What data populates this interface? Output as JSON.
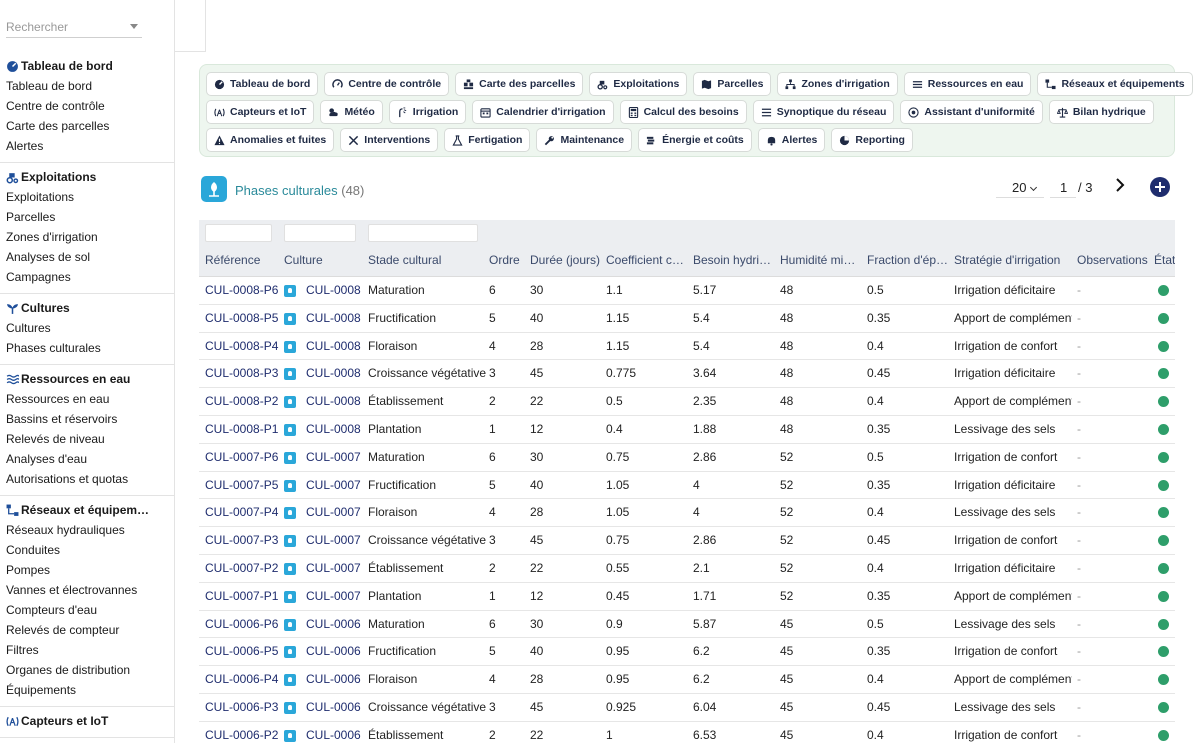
{
  "sidebar": {
    "search_placeholder": "Rechercher",
    "groups": [
      {
        "title": "Tableau de bord",
        "icon": "dashboard-gauge-icon",
        "items": [
          "Tableau de bord",
          "Centre de contrôle",
          "Carte des parcelles",
          "Alertes"
        ]
      },
      {
        "title": "Exploitations",
        "icon": "tractor-icon",
        "items": [
          "Exploitations",
          "Parcelles",
          "Zones d'irrigation",
          "Analyses de sol",
          "Campagnes"
        ]
      },
      {
        "title": "Cultures",
        "icon": "sprout-icon",
        "items": [
          "Cultures",
          "Phases culturales"
        ]
      },
      {
        "title": "Ressources en eau",
        "icon": "water-waves-icon",
        "items": [
          "Ressources en eau",
          "Bassins et réservoirs",
          "Relevés de niveau",
          "Analyses d'eau",
          "Autorisations et quotas"
        ]
      },
      {
        "title": "Réseaux et équipem…",
        "icon": "network-icon",
        "items": [
          "Réseaux hydrauliques",
          "Conduites",
          "Pompes",
          "Vannes et électrovannes",
          "Compteurs d'eau",
          "Relevés de compteur",
          "Filtres",
          "Organes de distribution",
          "Équipements"
        ]
      },
      {
        "title": "Capteurs et IoT",
        "icon": "sensor-icon",
        "items": []
      }
    ]
  },
  "quick_links": {
    "rows": [
      [
        {
          "label": "Tableau de bord",
          "icon": "gauge-icon"
        },
        {
          "label": "Centre de contrôle",
          "icon": "control-icon"
        },
        {
          "label": "Carte des parcelles",
          "icon": "map-grid-icon"
        },
        {
          "label": "Exploitations",
          "icon": "tractor-icon"
        },
        {
          "label": "Parcelles",
          "icon": "map-icon"
        },
        {
          "label": "Zones d'irrigation",
          "icon": "sitemap-icon"
        },
        {
          "label": "Ressources en eau",
          "icon": "water-icon"
        },
        {
          "label": "Réseaux et équipements",
          "icon": "network-icon"
        }
      ],
      [
        {
          "label": "Capteurs et IoT",
          "icon": "sensor-icon"
        },
        {
          "label": "Météo",
          "icon": "cloud-sun-icon"
        },
        {
          "label": "Irrigation",
          "icon": "sprinkler-icon"
        },
        {
          "label": "Calendrier d'irrigation",
          "icon": "calendar-icon"
        },
        {
          "label": "Calcul des besoins",
          "icon": "calculator-icon"
        },
        {
          "label": "Synoptique du réseau",
          "icon": "list-icon"
        },
        {
          "label": "Assistant d'uniformité",
          "icon": "target-icon"
        },
        {
          "label": "Bilan hydrique",
          "icon": "balance-icon"
        }
      ],
      [
        {
          "label": "Anomalies et fuites",
          "icon": "warning-icon"
        },
        {
          "label": "Interventions",
          "icon": "tools-icon"
        },
        {
          "label": "Fertigation",
          "icon": "flask-icon"
        },
        {
          "label": "Maintenance",
          "icon": "wrench-icon"
        },
        {
          "label": "Énergie et coûts",
          "icon": "coins-icon"
        },
        {
          "label": "Alertes",
          "icon": "bell-icon"
        },
        {
          "label": "Reporting",
          "icon": "chart-pie-icon"
        }
      ]
    ]
  },
  "list": {
    "title": "Phases culturales",
    "count": "(48)",
    "page_size": "20",
    "page": "1",
    "page_total": "/  3"
  },
  "table": {
    "columns": [
      "Référence",
      "Culture",
      "Stade cultural",
      "Ordre",
      "Durée (jours)",
      "Coefficient c…",
      "Besoin hydri…",
      "Humidité mi…",
      "Fraction d'ép…",
      "Stratégie d'irrigation",
      "Observations",
      "État"
    ],
    "rows": [
      [
        "CUL-0008-P6",
        "CUL-0008",
        "Maturation",
        "6",
        "30",
        "1.1",
        "5.17",
        "48",
        "0.5",
        "Irrigation déficitaire",
        "-"
      ],
      [
        "CUL-0008-P5",
        "CUL-0008",
        "Fructification",
        "5",
        "40",
        "1.15",
        "5.4",
        "48",
        "0.35",
        "Apport de complément",
        "-"
      ],
      [
        "CUL-0008-P4",
        "CUL-0008",
        "Floraison",
        "4",
        "28",
        "1.15",
        "5.4",
        "48",
        "0.4",
        "Irrigation de confort",
        "-"
      ],
      [
        "CUL-0008-P3",
        "CUL-0008",
        "Croissance végétative",
        "3",
        "45",
        "0.775",
        "3.64",
        "48",
        "0.45",
        "Irrigation déficitaire",
        "-"
      ],
      [
        "CUL-0008-P2",
        "CUL-0008",
        "Établissement",
        "2",
        "22",
        "0.5",
        "2.35",
        "48",
        "0.4",
        "Apport de complément",
        "-"
      ],
      [
        "CUL-0008-P1",
        "CUL-0008",
        "Plantation",
        "1",
        "12",
        "0.4",
        "1.88",
        "48",
        "0.35",
        "Lessivage des sels",
        "-"
      ],
      [
        "CUL-0007-P6",
        "CUL-0007",
        "Maturation",
        "6",
        "30",
        "0.75",
        "2.86",
        "52",
        "0.5",
        "Irrigation de confort",
        "-"
      ],
      [
        "CUL-0007-P5",
        "CUL-0007",
        "Fructification",
        "5",
        "40",
        "1.05",
        "4",
        "52",
        "0.35",
        "Irrigation déficitaire",
        "-"
      ],
      [
        "CUL-0007-P4",
        "CUL-0007",
        "Floraison",
        "4",
        "28",
        "1.05",
        "4",
        "52",
        "0.4",
        "Lessivage des sels",
        "-"
      ],
      [
        "CUL-0007-P3",
        "CUL-0007",
        "Croissance végétative",
        "3",
        "45",
        "0.75",
        "2.86",
        "52",
        "0.45",
        "Irrigation de confort",
        "-"
      ],
      [
        "CUL-0007-P2",
        "CUL-0007",
        "Établissement",
        "2",
        "22",
        "0.55",
        "2.1",
        "52",
        "0.4",
        "Irrigation déficitaire",
        "-"
      ],
      [
        "CUL-0007-P1",
        "CUL-0007",
        "Plantation",
        "1",
        "12",
        "0.45",
        "1.71",
        "52",
        "0.35",
        "Apport de complément",
        "-"
      ],
      [
        "CUL-0006-P6",
        "CUL-0006",
        "Maturation",
        "6",
        "30",
        "0.9",
        "5.87",
        "45",
        "0.5",
        "Lessivage des sels",
        "-"
      ],
      [
        "CUL-0006-P5",
        "CUL-0006",
        "Fructification",
        "5",
        "40",
        "0.95",
        "6.2",
        "45",
        "0.35",
        "Irrigation de confort",
        "-"
      ],
      [
        "CUL-0006-P4",
        "CUL-0006",
        "Floraison",
        "4",
        "28",
        "0.95",
        "6.2",
        "45",
        "0.4",
        "Apport de complément",
        "-"
      ],
      [
        "CUL-0006-P3",
        "CUL-0006",
        "Croissance végétative",
        "3",
        "45",
        "0.925",
        "6.04",
        "45",
        "0.45",
        "Lessivage des sels",
        "-"
      ],
      [
        "CUL-0006-P2",
        "CUL-0006",
        "Établissement",
        "2",
        "22",
        "1",
        "6.53",
        "45",
        "0.4",
        "Irrigation de confort",
        "-"
      ]
    ],
    "status_color": "#2e9e6a"
  }
}
